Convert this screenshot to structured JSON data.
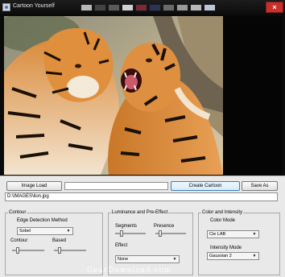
{
  "window": {
    "title": "Cartoon Yourself",
    "close_glyph": "×",
    "color_swatches": [
      "#b8b8b8",
      "#444444",
      "#5a5a5a",
      "#d0d0d0",
      "#7a2a36",
      "#2a3456",
      "#6a6a6a",
      "#9a9a9a",
      "#b8b8b8",
      "#bfc5d6"
    ]
  },
  "image_panel": {
    "description_icon": "tiger-photo-image"
  },
  "toolbar": {
    "image_load_label": "Image Load",
    "create_cartoon_label": "Create Cartoon",
    "save_as_label": "Save As",
    "progress": 0
  },
  "path_field": {
    "value": "D:\\IMAGES\\lion.jpg"
  },
  "contour_group": {
    "legend": "Contour",
    "edge_method_label": "Edge Detection Method",
    "edge_method_value": "Sobel",
    "contour_label": "Contour",
    "contour_value": 0.1,
    "based_label": "Based",
    "based_value": 0.1
  },
  "luminance_group": {
    "legend": "Luminance and Pre-Effect",
    "segments_label": "Segments",
    "segments_value": 0.15,
    "presence_label": "Presence",
    "presence_value": 0.1,
    "effect_label": "Effect",
    "effect_value": "None"
  },
  "color_group": {
    "legend": "Color and Intensity",
    "color_mode_label": "Color Mode",
    "color_mode_value": "Cie LAB",
    "intensity_mode_label": "Intensity Mode",
    "intensity_mode_value": "Gaussian 2"
  },
  "watermark": "GearDownload.com"
}
